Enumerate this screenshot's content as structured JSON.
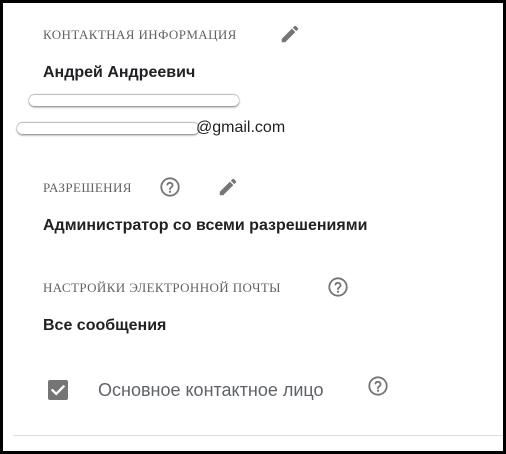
{
  "contact": {
    "label": "КОНТАКТНАЯ ИНФОРМАЦИЯ",
    "name": "Андрей Андреевич",
    "email_visible": "@gmail.com",
    "edit_icon": "pencil-icon"
  },
  "permissions": {
    "label": "РАЗРЕШЕНИЯ",
    "value": "Администратор со всеми разрешениями",
    "help_icon": "help-circle-icon",
    "edit_icon": "pencil-icon"
  },
  "email_settings": {
    "label": "НАСТРОЙКИ ЭЛЕКТРОННОЙ ПОЧТЫ",
    "value": "Все сообщения",
    "help_icon": "help-circle-icon"
  },
  "primary_contact": {
    "label": "Основное контактное лицо",
    "checked": true,
    "help_icon": "help-circle-icon"
  },
  "colors": {
    "label": "#5f6368",
    "text": "#202124",
    "icon": "#757575",
    "checkbox": "#757575"
  }
}
